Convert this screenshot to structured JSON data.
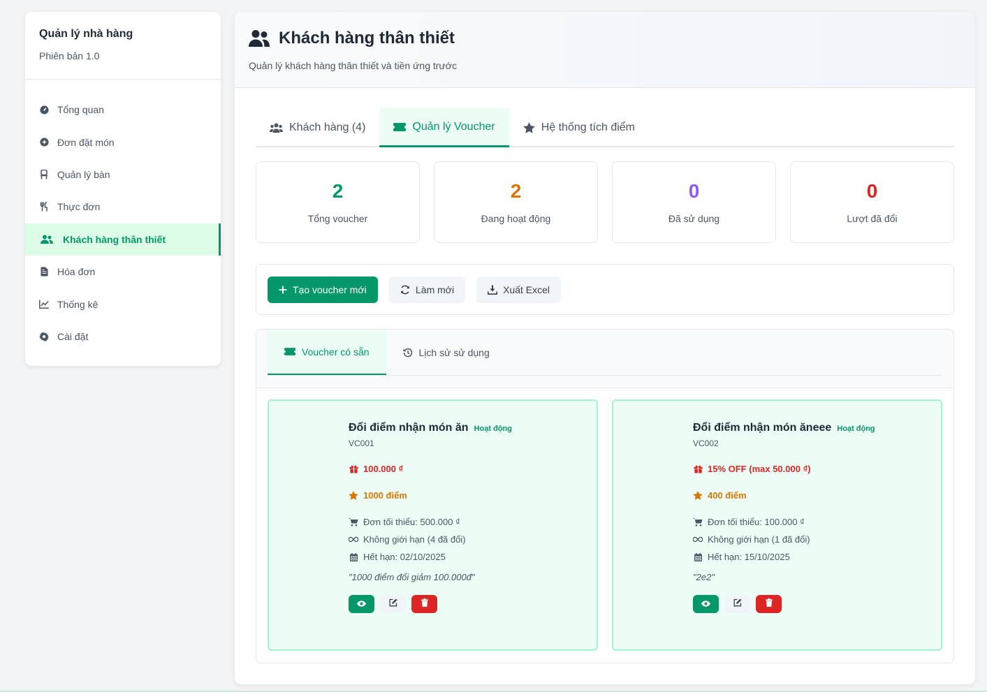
{
  "sidebar": {
    "title": "Quản lý nhà hàng",
    "version": "Phiên bản 1.0",
    "items": [
      {
        "label": "Tổng quan",
        "icon": "dashboard-icon"
      },
      {
        "label": "Đơn đặt món",
        "icon": "plus-circle-icon"
      },
      {
        "label": "Quản lý bàn",
        "icon": "chair-icon"
      },
      {
        "label": "Thực đơn",
        "icon": "utensils-icon"
      },
      {
        "label": "Khách hàng thân thiết",
        "icon": "users-icon",
        "active": true
      },
      {
        "label": "Hóa đơn",
        "icon": "file-icon"
      },
      {
        "label": "Thống kê",
        "icon": "chart-line-icon"
      },
      {
        "label": "Cài đặt",
        "icon": "gear-icon"
      }
    ]
  },
  "header": {
    "title": "Khách hàng thân thiết",
    "subtitle": "Quản lý khách hàng thân thiết và tiền ứng trước"
  },
  "tabs": [
    {
      "label": "Khách hàng (4)"
    },
    {
      "label": "Quản lý Voucher",
      "active": true
    },
    {
      "label": "Hệ thống tích điểm"
    }
  ],
  "stats": [
    {
      "value": "2",
      "label": "Tổng voucher",
      "color": "#059669"
    },
    {
      "value": "2",
      "label": "Đang hoạt động",
      "color": "#d97706"
    },
    {
      "value": "0",
      "label": "Đã sử dụng",
      "color": "#8b5cf6"
    },
    {
      "value": "0",
      "label": "Lượt đã đổi",
      "color": "#dc2626"
    }
  ],
  "toolbar": {
    "create_label": "Tạo voucher mới",
    "refresh_label": "Làm mới",
    "export_label": "Xuất Excel"
  },
  "subtabs": [
    {
      "label": "Voucher có sẵn",
      "active": true
    },
    {
      "label": "Lịch sử sử dụng"
    }
  ],
  "vouchers": [
    {
      "title": "Đổi điểm nhận món ăn",
      "status": "Hoạt động",
      "code": "VC001",
      "value": "100.000 ₫",
      "points": "1000 điểm",
      "min_order": "Đơn tối thiểu: 500.000 ₫",
      "limit": "Không giới hạn (4 đã đổi)",
      "expiry": "Hết hạn: 02/10/2025",
      "description": "\"1000 điểm đổi giảm 100.000đ\""
    },
    {
      "title": "Đổi điểm nhận món ăneee",
      "status": "Hoạt động",
      "code": "VC002",
      "value": "15% OFF (max 50.000 ₫)",
      "points": "400 điểm",
      "min_order": "Đơn tối thiểu: 100.000 ₫",
      "limit": "Không giới hạn (1 đã đổi)",
      "expiry": "Hết hạn: 15/10/2025",
      "description": "\"2e2\""
    }
  ],
  "colors": {
    "accent": "#059669",
    "danger": "#dc2626",
    "warning": "#d97706",
    "card_bg": "#ecfdf5"
  }
}
